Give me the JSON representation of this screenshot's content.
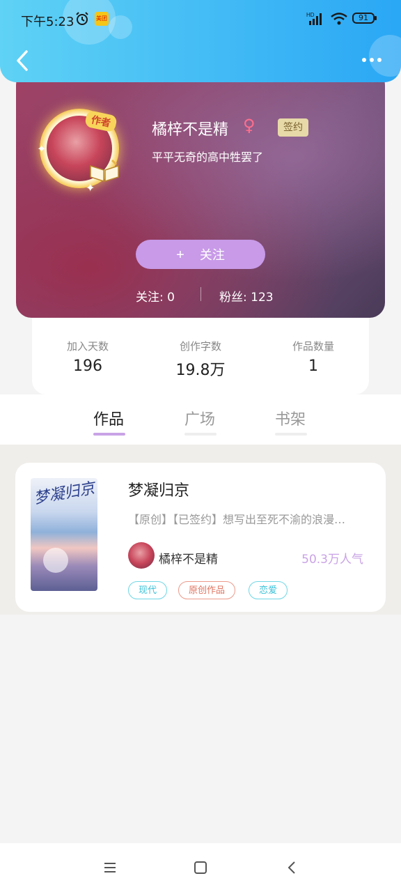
{
  "status_bar": {
    "time": "下午5:23",
    "app_badge_text": "美团",
    "network_label": "HD",
    "battery_level": "91"
  },
  "header": {
    "back_icon": "chevron-left-icon",
    "more_icon": "more-dots-icon"
  },
  "profile": {
    "author_badge": "作者",
    "username": "橘梓不是精",
    "gender_symbol": "♀",
    "signed_label": "签约",
    "bio": "平平无奇的高中牲罢了",
    "follow_plus": "+",
    "follow_label": "关注",
    "following_text": "关注: 0",
    "fans_text": "粉丝: 123"
  },
  "stats": [
    {
      "label": "加入天数",
      "value": "196"
    },
    {
      "label": "创作字数",
      "value": "19.8万"
    },
    {
      "label": "作品数量",
      "value": "1"
    }
  ],
  "tabs": [
    {
      "label": "作品",
      "active": true
    },
    {
      "label": "广场",
      "active": false
    },
    {
      "label": "书架",
      "active": false
    }
  ],
  "works": [
    {
      "cover_text": "梦凝归京",
      "title": "梦凝归京",
      "description": "【原创】【已签约】想写出至死不渝的浪漫…",
      "author": "橘梓不是精",
      "popularity": "50.3万人气",
      "tags": [
        {
          "label": "现代",
          "color": "#3cc2d8"
        },
        {
          "label": "原创作品",
          "color": "#e0735f"
        },
        {
          "label": "恋爱",
          "color": "#3cc2d8"
        }
      ]
    }
  ],
  "colors": {
    "header_gradient": [
      "#5fd2f5",
      "#2aa7f5"
    ],
    "accent_purple": "#c89ae8",
    "tab_active_underline": "#c9a3e6"
  },
  "navbar": {
    "menu_icon": "menu-lines-icon",
    "home_icon": "square-home-icon",
    "back_icon": "back-triangle-icon"
  }
}
